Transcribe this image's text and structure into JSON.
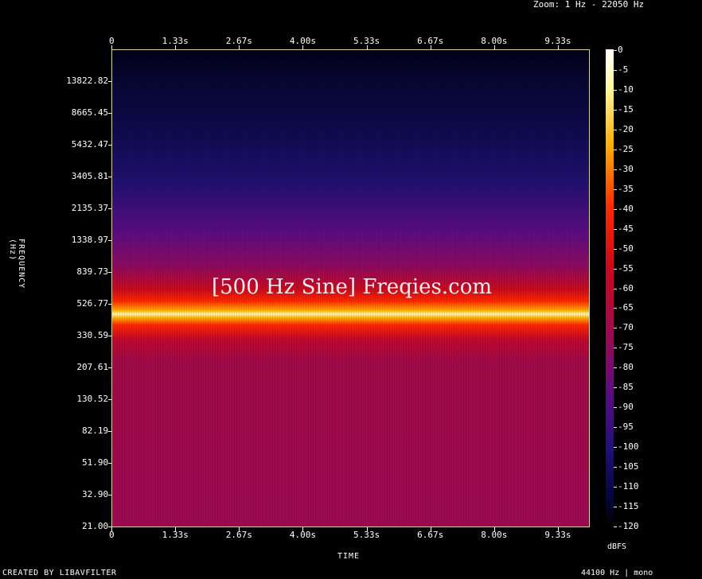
{
  "zoom_label": "Zoom: 1 Hz - 22050 Hz",
  "watermark": "[500 Hz Sine] Freqies.com",
  "footer_left": "CREATED BY LIBAVFILTER",
  "footer_right": "44100 Hz | mono",
  "colorbar_unit": "dBFS",
  "chart_data": {
    "type": "heatmap",
    "xlabel": "TIME",
    "ylabel": "FREQUENCY (Hz)",
    "x_ticks": [
      "0",
      "1.33s",
      "2.67s",
      "4.00s",
      "5.33s",
      "6.67s",
      "8.00s",
      "9.33s"
    ],
    "y_ticks": [
      "13822.82",
      "8665.45",
      "5432.47",
      "3405.81",
      "2135.37",
      "1338.97",
      "839.73",
      "526.77",
      "330.59",
      "207.61",
      "130.52",
      "82.19",
      "51.90",
      "32.90",
      "21.00"
    ],
    "y_scale": "log",
    "ylim": [
      21.0,
      22050
    ],
    "colorbar_ticks": [
      "0",
      "-5",
      "-10",
      "-15",
      "-20",
      "-25",
      "-30",
      "-35",
      "-40",
      "-45",
      "-50",
      "-55",
      "-60",
      "-65",
      "-70",
      "-75",
      "-80",
      "-85",
      "-90",
      "-95",
      "-100",
      "-105",
      "-110",
      "-115",
      "-120"
    ],
    "colorbar_range": [
      -120,
      0
    ],
    "tone_frequency_hz": 500,
    "colors": {
      "background": "#000000",
      "low": "#000010",
      "mid_low": "#1a0a6a",
      "mid": "#8a0a6a",
      "high": "#ff2a00",
      "peak": "#ffffa0"
    }
  }
}
